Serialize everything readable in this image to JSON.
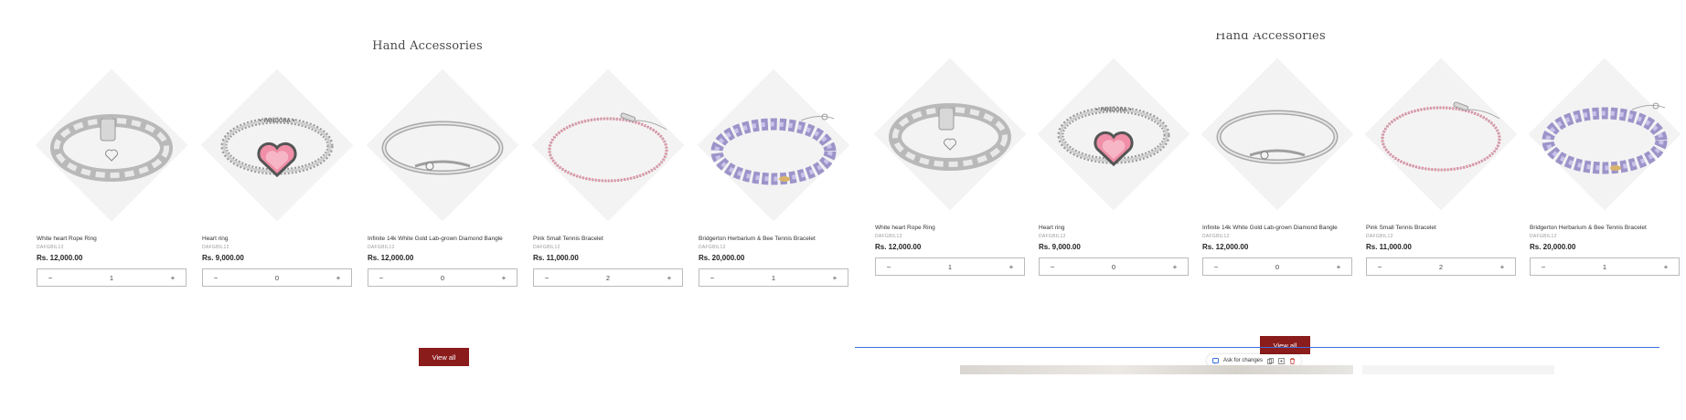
{
  "section_title": "Hand Accessories",
  "view_all_label": "View all",
  "ask_toolbar_label": "Ask for changes",
  "colors": {
    "view_all_bg": "#8a1c1c",
    "editor_line": "#3b6fe0",
    "diamond_bg": "#f3f3f3"
  },
  "icons": {
    "minus": "−",
    "plus": "+",
    "ask": "chat-icon",
    "copy": "copy-icon",
    "duplicate": "duplicate-icon",
    "delete": "trash-icon"
  },
  "panels": {
    "left": {
      "products": [
        {
          "name": "White heart Rope Ring",
          "sku": "DAFGBIL12",
          "price": "Rs. 12,000.00",
          "qty": "1",
          "image": "rope-ring"
        },
        {
          "name": "Heart ring",
          "sku": "DAFGBIL12",
          "price": "Rs. 9,000.00",
          "qty": "0",
          "image": "heart-ring"
        },
        {
          "name": "Infinite 14k White Gold Lab-grown Diamond Bangle",
          "sku": "DAFGBIL12",
          "price": "Rs. 12,000.00",
          "qty": "0",
          "image": "bangle"
        },
        {
          "name": "Pink Small Tennis Bracelet",
          "sku": "DAFGBIL12",
          "price": "Rs. 11,000.00",
          "qty": "2",
          "image": "tennis-bracelet"
        },
        {
          "name": "Bridgerton Herbarium & Bee Tennis Bracelet",
          "sku": "DAFGBIL12",
          "price": "Rs. 20,000.00",
          "qty": "1",
          "image": "herbarium-bracelet"
        }
      ]
    },
    "right": {
      "products": [
        {
          "name": "White heart Rope Ring",
          "sku": "DAFGBIL12",
          "price": "Rs. 12,000.00",
          "qty": "1",
          "image": "rope-ring"
        },
        {
          "name": "Heart ring",
          "sku": "DAFGBIL12",
          "price": "Rs. 9,000.00",
          "qty": "0",
          "image": "heart-ring"
        },
        {
          "name": "Infinite 14k White Gold Lab-grown Diamond Bangle",
          "sku": "DAFGBIL12",
          "price": "Rs. 12,000.00",
          "qty": "0",
          "image": "bangle"
        },
        {
          "name": "Pink Small Tennis Bracelet",
          "sku": "DAFGBIL12",
          "price": "Rs. 11,000.00",
          "qty": "2",
          "image": "tennis-bracelet"
        },
        {
          "name": "Bridgerton Herbarium & Bee Tennis Bracelet",
          "sku": "DAFGBIL12",
          "price": "Rs. 20,000.00",
          "qty": "1",
          "image": "herbarium-bracelet"
        }
      ]
    }
  }
}
